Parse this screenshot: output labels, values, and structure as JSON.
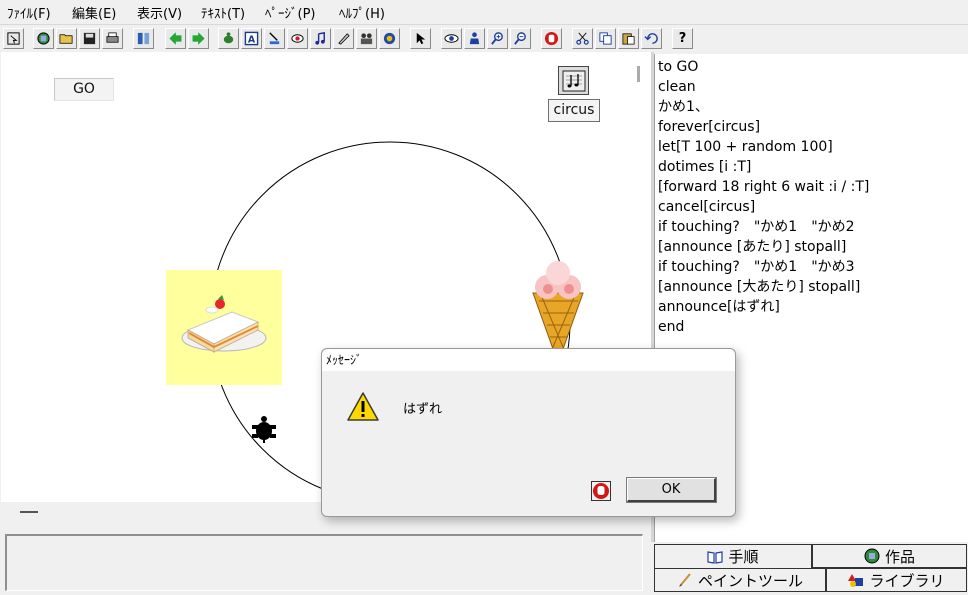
{
  "menu": [
    "ﾌｧｲﾙ(F)",
    "編集(E)",
    "表示(V)",
    "ﾃｷｽﾄ(T)",
    "ﾍﾟｰｼﾞ(P)",
    "ﾍﾙﾌﾟ(H)"
  ],
  "toolbar": {
    "icons": [
      "cursor-small-icon",
      "new-page-icon",
      "open-folder-icon",
      "save-icon",
      "print-icon",
      "page-list-icon",
      "prev-page-icon",
      "next-page-icon",
      "new-turtle-icon",
      "text-box-icon",
      "stamp-icon",
      "record-icon",
      "music-note-icon",
      "pen-icon",
      "video-icon",
      "world-icon",
      "arrow-pointer-icon",
      "eye-icon",
      "person-icon",
      "zoom-in-icon",
      "zoom-out-icon",
      "stop-icon",
      "cut-icon",
      "copy-icon",
      "paste-icon",
      "undo-icon",
      "help-icon"
    ],
    "help_label": "?"
  },
  "canvas": {
    "go_label": "GO",
    "circus_label": "circus"
  },
  "program": {
    "lines": [
      "to GO",
      "clean",
      "かめ1、",
      "forever[circus]",
      "let[T 100 + random 100]",
      "dotimes [i :T]",
      "[forward 18 right 6 wait :i / :T]",
      "cancel[circus]",
      "if touching?　\"かめ1　\"かめ2",
      "[announce [あたり] stopall]",
      "if touching?　\"かめ1　\"かめ3",
      "[announce [大あたり] stopall]",
      "announce[はずれ]",
      "end"
    ]
  },
  "tabs": {
    "procedures": "手順",
    "works": "作品",
    "paint_tool": "ペイントツール",
    "library": "ライブラリ"
  },
  "dialog": {
    "title": "ﾒｯｾｰｼﾞ",
    "message": "はずれ",
    "ok_label": "OK"
  }
}
